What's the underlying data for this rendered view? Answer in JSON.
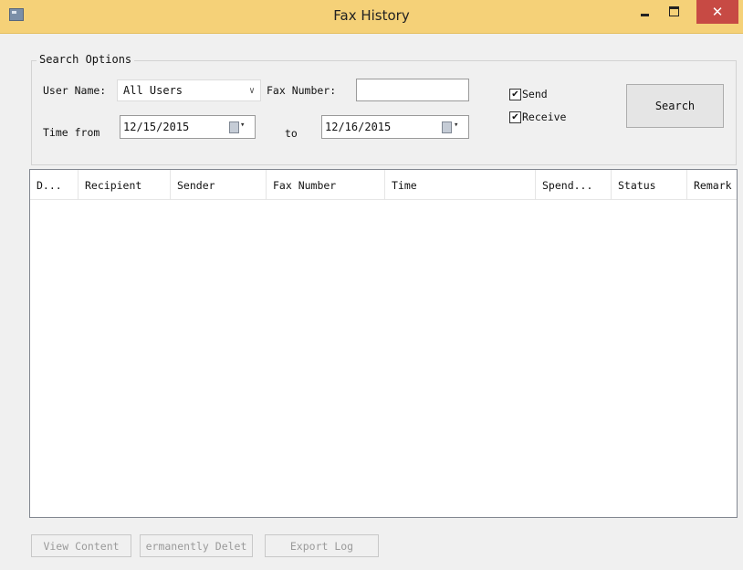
{
  "window": {
    "title": "Fax History",
    "close_glyph": "✕"
  },
  "search_options": {
    "legend": "Search Options",
    "user_name_label": "User Name:",
    "user_name_value": "All Users",
    "fax_number_label": "Fax Number:",
    "fax_number_value": "",
    "time_from_label": "Time from",
    "date_from": "12/15/2015",
    "to_label": "to",
    "date_to": "12/16/2015",
    "send_label": "Send",
    "send_checked": true,
    "receive_label": "Receive",
    "receive_checked": true,
    "checkmark": "✔",
    "search_button": "Search",
    "combo_arrow": "∨",
    "cal_arrow": "▾"
  },
  "table": {
    "columns": [
      "D...",
      "Recipient",
      "Sender",
      "Fax Number",
      "Time",
      "Spend...",
      "Status",
      "Remark"
    ],
    "rows": []
  },
  "bottom_buttons": {
    "view_content": "View Content",
    "permanently_delete": "ermanently Delet",
    "export_log": "Export Log"
  },
  "icons": {
    "app": "app-icon",
    "minimize": "minimize-icon",
    "maximize": "maximize-icon",
    "close": "close-icon",
    "calendar": "calendar-icon"
  }
}
